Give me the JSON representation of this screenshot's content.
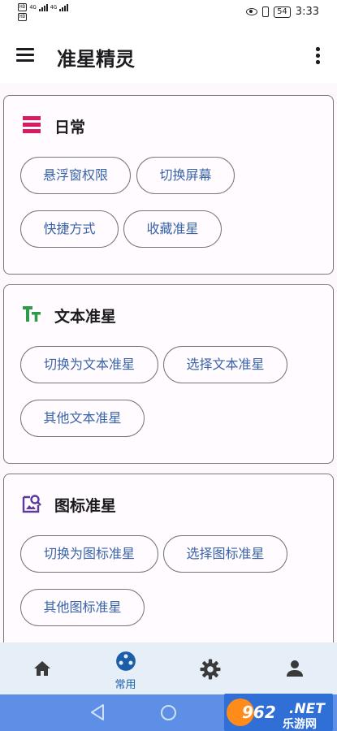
{
  "status_bar": {
    "hd1": "HD",
    "hd2": "HD",
    "net1": "4G",
    "net2": "4G",
    "battery": "54",
    "time": "3:33"
  },
  "app_bar": {
    "title": "准星精灵",
    "menu_icon": "hamburger-menu-icon",
    "more_icon": "more-vert-icon"
  },
  "cards": [
    {
      "title": "日常",
      "icon": "daily-icon",
      "icon_color": "#d81b60",
      "buttons": [
        "悬浮窗权限",
        "切换屏幕",
        "快捷方式",
        "收藏准星"
      ]
    },
    {
      "title": "文本准星",
      "icon": "text-icon",
      "icon_color": "#2e9a4a",
      "buttons": [
        "切换为文本准星",
        "选择文本准星",
        "其他文本准星"
      ]
    },
    {
      "title": "图标准星",
      "icon": "image-search-icon",
      "icon_color": "#5b3a9b",
      "buttons": [
        "切换为图标准星",
        "选择图标准星",
        "其他图标准星"
      ]
    }
  ],
  "bottom_nav": {
    "items": [
      {
        "icon": "home-icon",
        "label": ""
      },
      {
        "icon": "palette-icon",
        "label": "常用",
        "active": true
      },
      {
        "icon": "settings-icon",
        "label": ""
      },
      {
        "icon": "person-icon",
        "label": ""
      }
    ],
    "active_color": "#1c5ea8",
    "inactive_color": "#3a3a3a"
  },
  "watermark": {
    "site": "962.NET",
    "tagline": "乐游网"
  },
  "colors": {
    "background": "#fdf8fc",
    "chip_text": "#3a64a8",
    "card_border": "#7a757f",
    "system_nav": "#5c8fe5"
  }
}
